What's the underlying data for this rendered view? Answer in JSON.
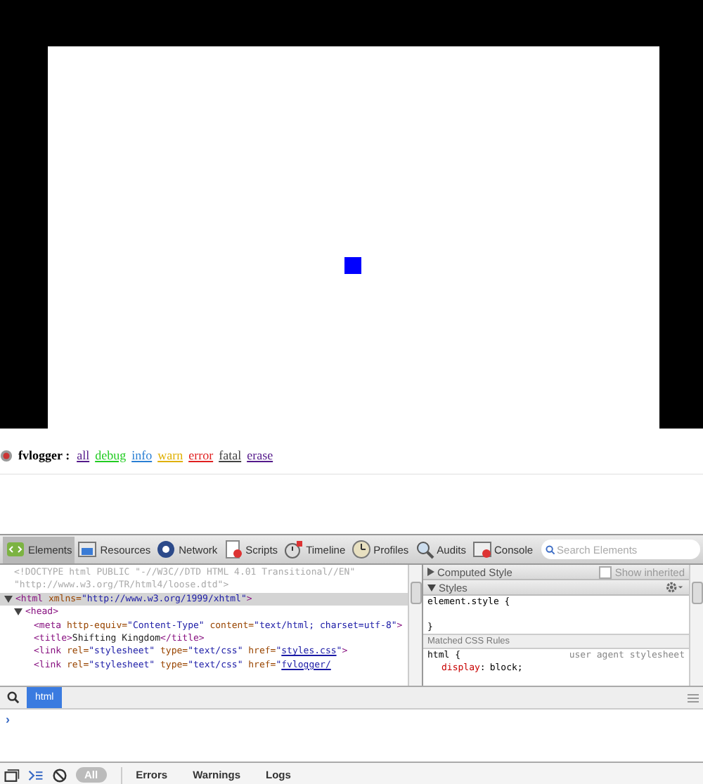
{
  "logger": {
    "name": "fvlogger :",
    "links": [
      {
        "label": "all",
        "color": "#551a8b"
      },
      {
        "label": "debug",
        "color": "#22cc22"
      },
      {
        "label": "info",
        "color": "#2a7fd4"
      },
      {
        "label": "warn",
        "color": "#e0b000"
      },
      {
        "label": "error",
        "color": "#e02020"
      },
      {
        "label": "fatal",
        "color": "#444444"
      },
      {
        "label": "erase",
        "color": "#551a8b"
      }
    ]
  },
  "devtools": {
    "tabs": [
      {
        "label": "Elements",
        "selected": true
      },
      {
        "label": "Resources",
        "selected": false
      },
      {
        "label": "Network",
        "selected": false
      },
      {
        "label": "Scripts",
        "selected": false
      },
      {
        "label": "Timeline",
        "selected": false
      },
      {
        "label": "Profiles",
        "selected": false
      },
      {
        "label": "Audits",
        "selected": false
      },
      {
        "label": "Console",
        "selected": false
      }
    ],
    "search": {
      "placeholder": "Search Elements"
    },
    "dom": {
      "doctype": "<!DOCTYPE html PUBLIC \"-//W3C//DTD HTML 4.01 Transitional//EN\" \"http://www.w3.org/TR/html4/loose.dtd\">",
      "nodes": [
        {
          "expanded": true,
          "selected": true,
          "tokens": [
            {
              "kind": "tag",
              "text": "<html "
            },
            {
              "kind": "attr",
              "text": "xmlns="
            },
            {
              "kind": "value",
              "text": "\"http://www.w3.org/1999/xhtml\""
            },
            {
              "kind": "tag",
              "text": ">"
            }
          ],
          "children": [
            {
              "expanded": true,
              "selected": false,
              "tokens": [
                {
                  "kind": "tag",
                  "text": "<head>"
                }
              ],
              "children": [
                {
                  "tokens": [
                    {
                      "kind": "tag",
                      "text": "<meta "
                    },
                    {
                      "kind": "attr",
                      "text": "http-equiv="
                    },
                    {
                      "kind": "value",
                      "text": "\"Content-Type\" "
                    },
                    {
                      "kind": "attr",
                      "text": "content="
                    },
                    {
                      "kind": "value",
                      "text": "\"text/html; charset=utf-8\""
                    },
                    {
                      "kind": "tag",
                      "text": ">"
                    }
                  ]
                },
                {
                  "tokens": [
                    {
                      "kind": "tag",
                      "text": "<title>"
                    },
                    {
                      "kind": "text",
                      "text": "Shifting Kingdom"
                    },
                    {
                      "kind": "tag",
                      "text": "</title>"
                    }
                  ]
                },
                {
                  "tokens": [
                    {
                      "kind": "tag",
                      "text": "<link "
                    },
                    {
                      "kind": "attr",
                      "text": "rel="
                    },
                    {
                      "kind": "value",
                      "text": "\"stylesheet\" "
                    },
                    {
                      "kind": "attr",
                      "text": "type="
                    },
                    {
                      "kind": "value",
                      "text": "\"text/css\" "
                    },
                    {
                      "kind": "attr",
                      "text": "href="
                    },
                    {
                      "kind": "value",
                      "text": "\""
                    },
                    {
                      "kind": "link",
                      "text": "styles.css"
                    },
                    {
                      "kind": "value",
                      "text": "\""
                    },
                    {
                      "kind": "tag",
                      "text": ">"
                    }
                  ]
                },
                {
                  "tokens": [
                    {
                      "kind": "tag",
                      "text": "<link "
                    },
                    {
                      "kind": "attr",
                      "text": "rel="
                    },
                    {
                      "kind": "value",
                      "text": "\"stylesheet\" "
                    },
                    {
                      "kind": "attr",
                      "text": "type="
                    },
                    {
                      "kind": "value",
                      "text": "\"text/css\" "
                    },
                    {
                      "kind": "attr",
                      "text": "href="
                    },
                    {
                      "kind": "value",
                      "text": "\""
                    },
                    {
                      "kind": "link",
                      "text": "fvlogger/"
                    }
                  ]
                }
              ]
            }
          ]
        }
      ]
    },
    "styles": {
      "computed": {
        "label": "Computed Style",
        "expanded": false
      },
      "show_inherited": {
        "label": "Show inherited",
        "checked": false
      },
      "styles": {
        "label": "Styles",
        "expanded": true
      },
      "element_style": [
        "element.style {",
        "}"
      ],
      "matched_header": "Matched CSS Rules",
      "rules": [
        {
          "selector": "html {",
          "source": "user agent stylesheet",
          "properties": [
            {
              "name": "display",
              "separator": ":",
              "value": "block;"
            }
          ]
        }
      ]
    },
    "breadcrumb": [
      {
        "label": "html",
        "selected": true
      }
    ],
    "console": {
      "prompt": "›"
    },
    "filters": [
      {
        "label": "All",
        "selected": true
      },
      {
        "label": "Errors",
        "selected": false
      },
      {
        "label": "Warnings",
        "selected": false
      },
      {
        "label": "Logs",
        "selected": false
      }
    ]
  }
}
